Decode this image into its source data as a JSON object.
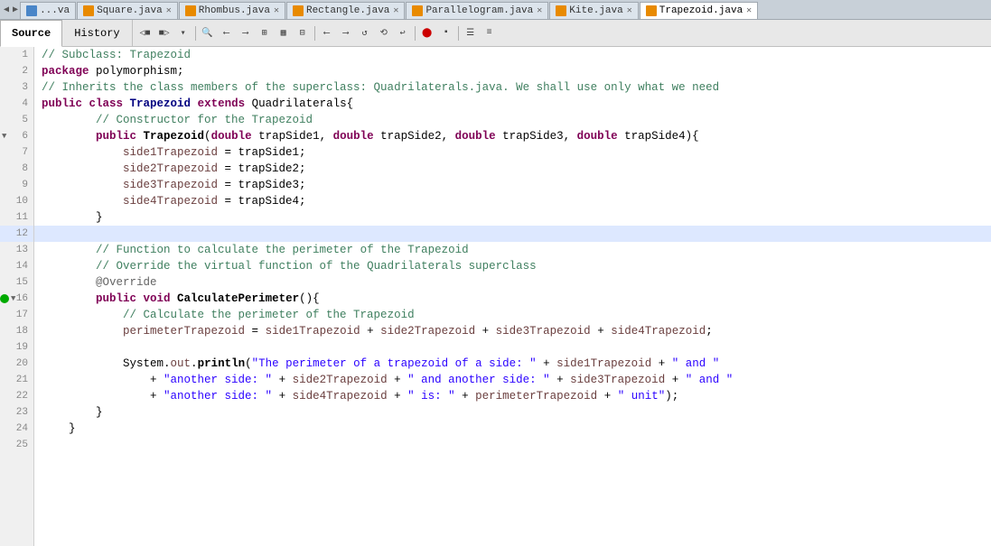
{
  "tabs": [
    {
      "label": "...va",
      "icon": "orange",
      "active": false,
      "close": false
    },
    {
      "label": "Square.java",
      "icon": "orange",
      "active": false,
      "close": true
    },
    {
      "label": "Rhombus.java",
      "icon": "orange",
      "active": false,
      "close": true
    },
    {
      "label": "Rectangle.java",
      "icon": "orange",
      "active": false,
      "close": true
    },
    {
      "label": "Parallelogram.java",
      "icon": "orange",
      "active": false,
      "close": true
    },
    {
      "label": "Kite.java",
      "icon": "orange",
      "active": false,
      "close": true
    },
    {
      "label": "Trapezoid.java",
      "icon": "orange",
      "active": true,
      "close": true
    }
  ],
  "source_tab": "Source",
  "history_tab": "History",
  "active_tab": "Source",
  "lines": [
    {
      "num": 1,
      "fold": false,
      "bp": false,
      "green": false,
      "highlight": false
    },
    {
      "num": 2,
      "fold": false,
      "bp": false,
      "green": false,
      "highlight": false
    },
    {
      "num": 3,
      "fold": false,
      "bp": false,
      "green": false,
      "highlight": false
    },
    {
      "num": 4,
      "fold": false,
      "bp": false,
      "green": false,
      "highlight": false
    },
    {
      "num": 5,
      "fold": false,
      "bp": false,
      "green": false,
      "highlight": false
    },
    {
      "num": 6,
      "fold": true,
      "bp": false,
      "green": false,
      "highlight": false
    },
    {
      "num": 7,
      "fold": false,
      "bp": false,
      "green": false,
      "highlight": false
    },
    {
      "num": 8,
      "fold": false,
      "bp": false,
      "green": false,
      "highlight": false
    },
    {
      "num": 9,
      "fold": false,
      "bp": false,
      "green": false,
      "highlight": false
    },
    {
      "num": 10,
      "fold": false,
      "bp": false,
      "green": false,
      "highlight": false
    },
    {
      "num": 11,
      "fold": false,
      "bp": false,
      "green": false,
      "highlight": false
    },
    {
      "num": 12,
      "fold": false,
      "bp": false,
      "green": false,
      "highlight": true
    },
    {
      "num": 13,
      "fold": false,
      "bp": false,
      "green": false,
      "highlight": false
    },
    {
      "num": 14,
      "fold": false,
      "bp": false,
      "green": false,
      "highlight": false
    },
    {
      "num": 15,
      "fold": false,
      "bp": false,
      "green": false,
      "highlight": false
    },
    {
      "num": 16,
      "fold": true,
      "bp": false,
      "green": true,
      "highlight": false
    },
    {
      "num": 17,
      "fold": false,
      "bp": false,
      "green": false,
      "highlight": false
    },
    {
      "num": 18,
      "fold": false,
      "bp": false,
      "green": false,
      "highlight": false
    },
    {
      "num": 19,
      "fold": false,
      "bp": false,
      "green": false,
      "highlight": false
    },
    {
      "num": 20,
      "fold": false,
      "bp": false,
      "green": false,
      "highlight": false
    },
    {
      "num": 21,
      "fold": false,
      "bp": false,
      "green": false,
      "highlight": false
    },
    {
      "num": 22,
      "fold": false,
      "bp": false,
      "green": false,
      "highlight": false
    },
    {
      "num": 23,
      "fold": false,
      "bp": false,
      "green": false,
      "highlight": false
    },
    {
      "num": 24,
      "fold": false,
      "bp": false,
      "green": false,
      "highlight": false
    },
    {
      "num": 25,
      "fold": false,
      "bp": false,
      "green": false,
      "highlight": false
    }
  ]
}
